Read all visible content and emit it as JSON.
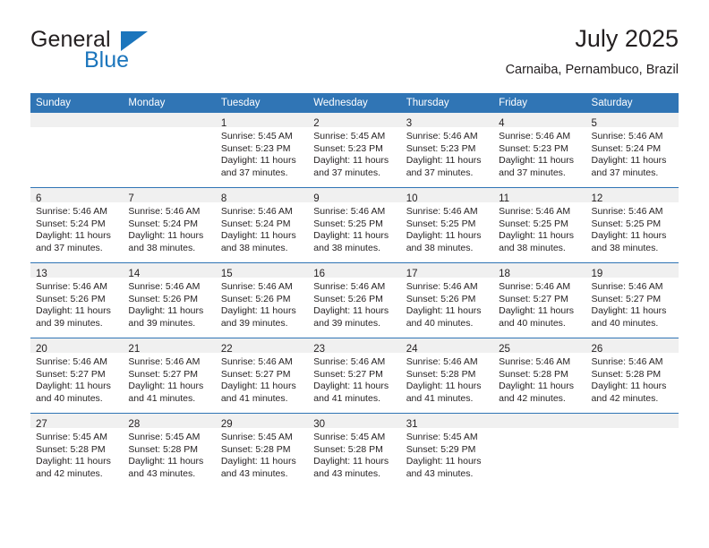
{
  "brand": {
    "name_part1": "General",
    "name_part2": "Blue",
    "triangle_icon": "triangle-icon",
    "colors": {
      "dark": "#231f20",
      "blue": "#1b75bc"
    }
  },
  "header": {
    "title": "July 2025",
    "subtitle": "Carnaiba, Pernambuco, Brazil"
  },
  "calendar": {
    "header_bg": "#3075b5",
    "daynum_bg": "#f0f0f0",
    "weekdays": [
      "Sunday",
      "Monday",
      "Tuesday",
      "Wednesday",
      "Thursday",
      "Friday",
      "Saturday"
    ],
    "weeks": [
      [
        {
          "day": "",
          "lines": []
        },
        {
          "day": "",
          "lines": []
        },
        {
          "day": "1",
          "lines": [
            "Sunrise: 5:45 AM",
            "Sunset: 5:23 PM",
            "Daylight: 11 hours",
            "and 37 minutes."
          ]
        },
        {
          "day": "2",
          "lines": [
            "Sunrise: 5:45 AM",
            "Sunset: 5:23 PM",
            "Daylight: 11 hours",
            "and 37 minutes."
          ]
        },
        {
          "day": "3",
          "lines": [
            "Sunrise: 5:46 AM",
            "Sunset: 5:23 PM",
            "Daylight: 11 hours",
            "and 37 minutes."
          ]
        },
        {
          "day": "4",
          "lines": [
            "Sunrise: 5:46 AM",
            "Sunset: 5:23 PM",
            "Daylight: 11 hours",
            "and 37 minutes."
          ]
        },
        {
          "day": "5",
          "lines": [
            "Sunrise: 5:46 AM",
            "Sunset: 5:24 PM",
            "Daylight: 11 hours",
            "and 37 minutes."
          ]
        }
      ],
      [
        {
          "day": "6",
          "lines": [
            "Sunrise: 5:46 AM",
            "Sunset: 5:24 PM",
            "Daylight: 11 hours",
            "and 37 minutes."
          ]
        },
        {
          "day": "7",
          "lines": [
            "Sunrise: 5:46 AM",
            "Sunset: 5:24 PM",
            "Daylight: 11 hours",
            "and 38 minutes."
          ]
        },
        {
          "day": "8",
          "lines": [
            "Sunrise: 5:46 AM",
            "Sunset: 5:24 PM",
            "Daylight: 11 hours",
            "and 38 minutes."
          ]
        },
        {
          "day": "9",
          "lines": [
            "Sunrise: 5:46 AM",
            "Sunset: 5:25 PM",
            "Daylight: 11 hours",
            "and 38 minutes."
          ]
        },
        {
          "day": "10",
          "lines": [
            "Sunrise: 5:46 AM",
            "Sunset: 5:25 PM",
            "Daylight: 11 hours",
            "and 38 minutes."
          ]
        },
        {
          "day": "11",
          "lines": [
            "Sunrise: 5:46 AM",
            "Sunset: 5:25 PM",
            "Daylight: 11 hours",
            "and 38 minutes."
          ]
        },
        {
          "day": "12",
          "lines": [
            "Sunrise: 5:46 AM",
            "Sunset: 5:25 PM",
            "Daylight: 11 hours",
            "and 38 minutes."
          ]
        }
      ],
      [
        {
          "day": "13",
          "lines": [
            "Sunrise: 5:46 AM",
            "Sunset: 5:26 PM",
            "Daylight: 11 hours",
            "and 39 minutes."
          ]
        },
        {
          "day": "14",
          "lines": [
            "Sunrise: 5:46 AM",
            "Sunset: 5:26 PM",
            "Daylight: 11 hours",
            "and 39 minutes."
          ]
        },
        {
          "day": "15",
          "lines": [
            "Sunrise: 5:46 AM",
            "Sunset: 5:26 PM",
            "Daylight: 11 hours",
            "and 39 minutes."
          ]
        },
        {
          "day": "16",
          "lines": [
            "Sunrise: 5:46 AM",
            "Sunset: 5:26 PM",
            "Daylight: 11 hours",
            "and 39 minutes."
          ]
        },
        {
          "day": "17",
          "lines": [
            "Sunrise: 5:46 AM",
            "Sunset: 5:26 PM",
            "Daylight: 11 hours",
            "and 40 minutes."
          ]
        },
        {
          "day": "18",
          "lines": [
            "Sunrise: 5:46 AM",
            "Sunset: 5:27 PM",
            "Daylight: 11 hours",
            "and 40 minutes."
          ]
        },
        {
          "day": "19",
          "lines": [
            "Sunrise: 5:46 AM",
            "Sunset: 5:27 PM",
            "Daylight: 11 hours",
            "and 40 minutes."
          ]
        }
      ],
      [
        {
          "day": "20",
          "lines": [
            "Sunrise: 5:46 AM",
            "Sunset: 5:27 PM",
            "Daylight: 11 hours",
            "and 40 minutes."
          ]
        },
        {
          "day": "21",
          "lines": [
            "Sunrise: 5:46 AM",
            "Sunset: 5:27 PM",
            "Daylight: 11 hours",
            "and 41 minutes."
          ]
        },
        {
          "day": "22",
          "lines": [
            "Sunrise: 5:46 AM",
            "Sunset: 5:27 PM",
            "Daylight: 11 hours",
            "and 41 minutes."
          ]
        },
        {
          "day": "23",
          "lines": [
            "Sunrise: 5:46 AM",
            "Sunset: 5:27 PM",
            "Daylight: 11 hours",
            "and 41 minutes."
          ]
        },
        {
          "day": "24",
          "lines": [
            "Sunrise: 5:46 AM",
            "Sunset: 5:28 PM",
            "Daylight: 11 hours",
            "and 41 minutes."
          ]
        },
        {
          "day": "25",
          "lines": [
            "Sunrise: 5:46 AM",
            "Sunset: 5:28 PM",
            "Daylight: 11 hours",
            "and 42 minutes."
          ]
        },
        {
          "day": "26",
          "lines": [
            "Sunrise: 5:46 AM",
            "Sunset: 5:28 PM",
            "Daylight: 11 hours",
            "and 42 minutes."
          ]
        }
      ],
      [
        {
          "day": "27",
          "lines": [
            "Sunrise: 5:45 AM",
            "Sunset: 5:28 PM",
            "Daylight: 11 hours",
            "and 42 minutes."
          ]
        },
        {
          "day": "28",
          "lines": [
            "Sunrise: 5:45 AM",
            "Sunset: 5:28 PM",
            "Daylight: 11 hours",
            "and 43 minutes."
          ]
        },
        {
          "day": "29",
          "lines": [
            "Sunrise: 5:45 AM",
            "Sunset: 5:28 PM",
            "Daylight: 11 hours",
            "and 43 minutes."
          ]
        },
        {
          "day": "30",
          "lines": [
            "Sunrise: 5:45 AM",
            "Sunset: 5:28 PM",
            "Daylight: 11 hours",
            "and 43 minutes."
          ]
        },
        {
          "day": "31",
          "lines": [
            "Sunrise: 5:45 AM",
            "Sunset: 5:29 PM",
            "Daylight: 11 hours",
            "and 43 minutes."
          ]
        },
        {
          "day": "",
          "lines": []
        },
        {
          "day": "",
          "lines": []
        }
      ]
    ]
  }
}
